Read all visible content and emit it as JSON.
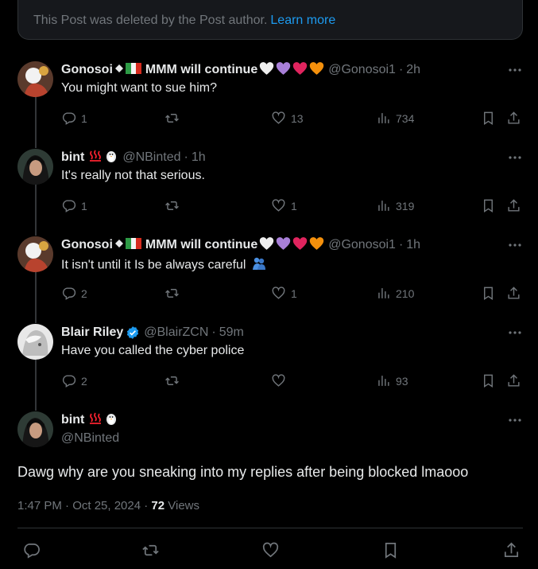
{
  "notice": {
    "text": "This Post was deleted by the Post author.",
    "link": "Learn more"
  },
  "replies": [
    {
      "name": "Gonosoi",
      "name_suffix": "MMM will continue",
      "handle": "@Gonosoi1",
      "time": "2h",
      "text": "You might want to sue him?",
      "replies": "1",
      "reposts": "",
      "likes": "13",
      "views": "734"
    },
    {
      "name": "bint",
      "name_suffix": "",
      "handle": "@NBinted",
      "time": "1h",
      "text": "It's really not that serious.",
      "replies": "1",
      "reposts": "",
      "likes": "1",
      "views": "319"
    },
    {
      "name": "Gonosoi",
      "name_suffix": "MMM will continue",
      "handle": "@Gonosoi1",
      "time": "1h",
      "text": "It isn't until it Is be always careful",
      "replies": "2",
      "reposts": "",
      "likes": "1",
      "views": "210"
    },
    {
      "name": "Blair Riley",
      "name_suffix": "",
      "handle": "@BlairZCN",
      "time": "59m",
      "text": "Have you called the cyber police",
      "replies": "2",
      "reposts": "",
      "likes": "",
      "views": "93"
    }
  ],
  "main": {
    "name": "bint",
    "handle": "@NBinted",
    "text": "Dawg why are you sneaking into my replies after being blocked lmaooo",
    "timestamp": "1:47 PM · Oct 25, 2024 · ",
    "views_count": "72",
    "views_label": " Views"
  },
  "colors": {
    "accent": "#1d9bf0",
    "muted": "#71767b",
    "text": "#e7e9ea",
    "border": "#2f3336"
  }
}
